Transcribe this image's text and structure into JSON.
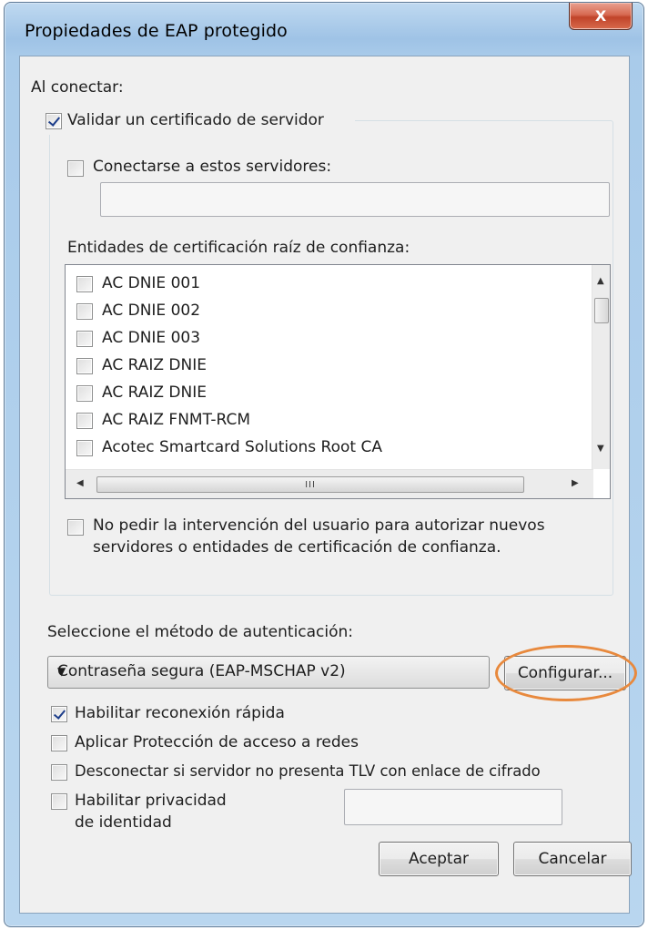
{
  "window": {
    "title": "Propiedades de EAP protegido",
    "close_label": "X"
  },
  "connect": {
    "heading": "Al conectar:",
    "validate_cert": {
      "label": "Validar un certificado de servidor",
      "checked": true
    },
    "connect_servers": {
      "label": "Conectarse a estos servidores:",
      "checked": false,
      "value": ""
    },
    "root_ca_heading": "Entidades de certificación raíz de confianza:",
    "root_ca_items": [
      {
        "label": "AC DNIE 001",
        "checked": false
      },
      {
        "label": "AC DNIE 002",
        "checked": false
      },
      {
        "label": "AC DNIE 003",
        "checked": false
      },
      {
        "label": "AC RAIZ DNIE",
        "checked": false
      },
      {
        "label": "AC RAIZ DNIE",
        "checked": false
      },
      {
        "label": "AC RAIZ FNMT-RCM",
        "checked": false
      },
      {
        "label": "Acotec Smartcard Solutions Root CA",
        "checked": false
      }
    ],
    "hscroll_grip": "III",
    "no_prompt": {
      "label_line1": "No pedir la intervención del usuario para autorizar nuevos",
      "label_line2": "servidores o entidades de certificación de confianza.",
      "checked": false
    }
  },
  "auth": {
    "heading": "Seleccione el método de autenticación:",
    "method_selected": "Contraseña segura (EAP-MSCHAP v2)",
    "configure_label": "Configurar..."
  },
  "options": {
    "fast_reconnect": {
      "label": "Habilitar reconexión rápida",
      "checked": true
    },
    "nap": {
      "label": "Aplicar Protección de acceso a redes",
      "checked": false
    },
    "tlv": {
      "label": "Desconectar si servidor no presenta TLV con enlace de cifrado",
      "checked": false
    },
    "identity_privacy": {
      "label_line1": "Habilitar privacidad",
      "label_line2": "de identidad",
      "checked": false,
      "value": ""
    }
  },
  "buttons": {
    "ok_label": "Aceptar",
    "cancel_label": "Cancelar"
  },
  "colors": {
    "highlight_ring": "#e8893d",
    "check_mark": "#1c3d8a",
    "close_button": "#c0442a"
  }
}
